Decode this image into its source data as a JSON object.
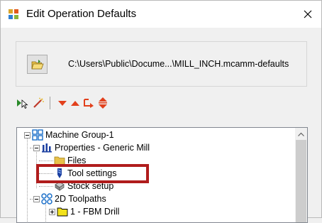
{
  "window": {
    "title": "Edit Operation Defaults"
  },
  "file": {
    "path": "C:\\Users\\Public\\Docume...\\MILL_INCH.mcamm-defaults"
  },
  "toolbar": {
    "icons": [
      "select-arrow-icon",
      "magic-wand-icon",
      "move-down-icon",
      "move-up-icon",
      "move-after-icon",
      "expand-collapse-icon"
    ]
  },
  "tree": {
    "items": [
      {
        "label": "Machine Group-1"
      },
      {
        "label": "Properties - Generic Mill"
      },
      {
        "label": "Files"
      },
      {
        "label": "Tool settings"
      },
      {
        "label": "Stock setup"
      },
      {
        "label": "2D Toolpaths"
      },
      {
        "label": "1 - FBM Drill"
      }
    ]
  },
  "colors": {
    "highlight": "#b01c1c",
    "accent": "#0078d7"
  }
}
